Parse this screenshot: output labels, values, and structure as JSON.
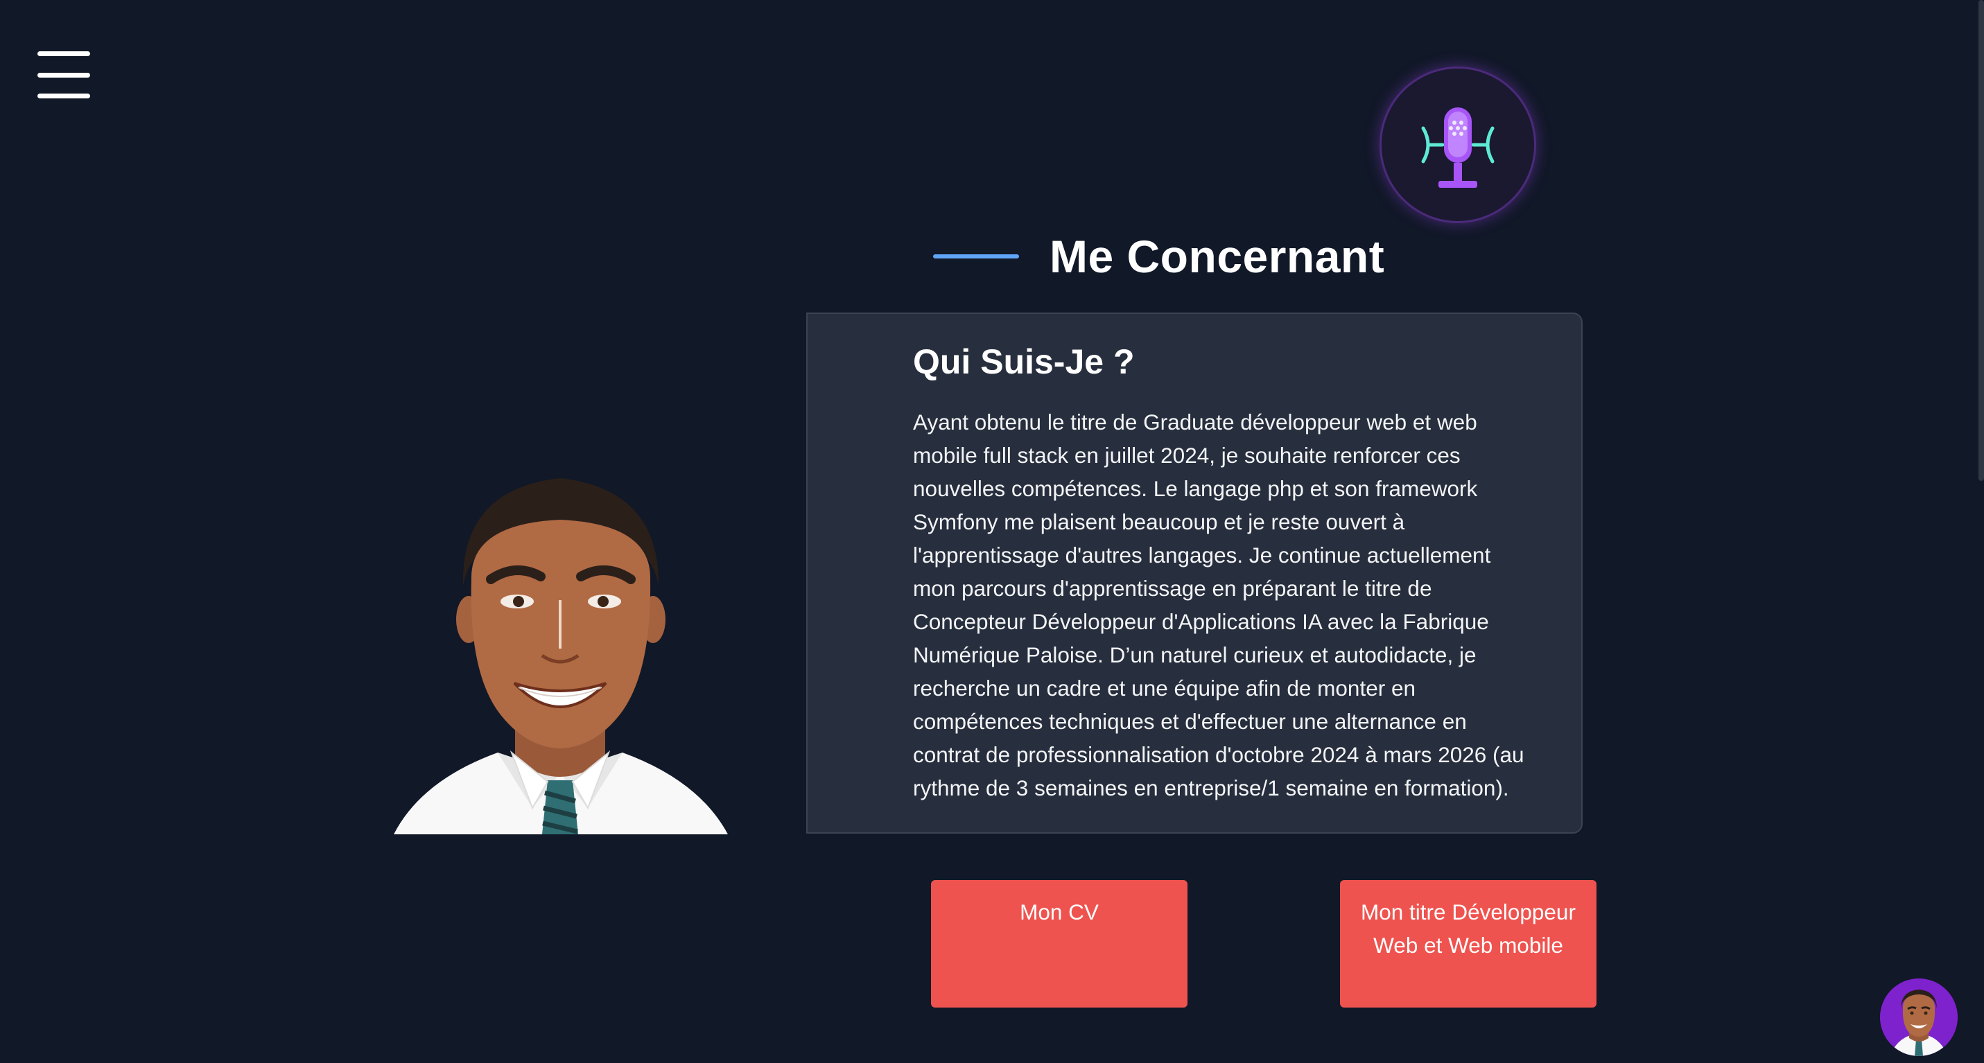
{
  "nav": {
    "menu_icon": "hamburger-menu-icon"
  },
  "voice": {
    "icon": "microphone-icon",
    "accent": "#a855f7",
    "wave_color": "#5eead4"
  },
  "section": {
    "title": "Me Concernant",
    "line_color": "#60a5fa"
  },
  "about": {
    "heading": "Qui Suis-Je ?",
    "text": "Ayant obtenu le titre de Graduate développeur web et web mobile full stack en juillet 2024, je souhaite renforcer ces nouvelles compétences. Le langage php et son framework Symfony me plaisent beaucoup et je reste ouvert à l'apprentissage d'autres langages. Je continue actuellement mon parcours d'apprentissage en préparant le titre de Concepteur Développeur d'Applications IA avec la Fabrique Numérique Paloise. D’un naturel curieux et autodidacte, je recherche un cadre et une équipe afin de monter en compétences techniques et d'effectuer une alternance en contrat de professionnalisation d'octobre 2024 à mars 2026 (au rythme de 3 semaines en entreprise/1 semaine en formation)."
  },
  "buttons": {
    "cv": "Mon CV",
    "title": "Mon titre Développeur Web et Web mobile",
    "color": "#ef534f"
  },
  "chat": {
    "avatar_icon": "chatbot-avatar-icon",
    "color": "#7e22ce"
  },
  "colors": {
    "background": "#111827",
    "card": "#272e3d"
  }
}
